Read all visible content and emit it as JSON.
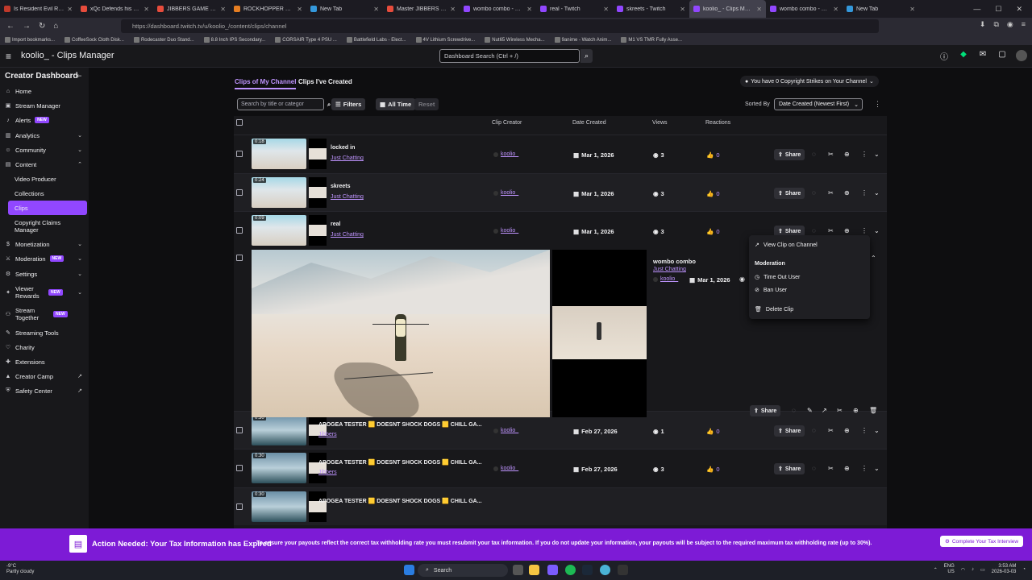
{
  "browser": {
    "tabs": [
      {
        "label": "Is Resident Evil Requiem",
        "color": "#c0392b"
      },
      {
        "label": "xQc Defends his Basketb",
        "color": "#e74c3c"
      },
      {
        "label": "JIBBERS GAME #sking #",
        "color": "#e74c3c"
      },
      {
        "label": "ROCKHOPPER PENGUIN",
        "color": "#e67e22"
      },
      {
        "label": "New Tab",
        "color": "#3498db"
      },
      {
        "label": "Master JIBBERS Fast - Yo",
        "color": "#e74c3c"
      },
      {
        "label": "wombo combo - Twitch",
        "color": "#9147ff"
      },
      {
        "label": "real - Twitch",
        "color": "#9147ff"
      },
      {
        "label": "skreets - Twitch",
        "color": "#9147ff"
      },
      {
        "label": "koolio_ - Clips Manager",
        "color": "#9147ff",
        "active": true
      },
      {
        "label": "wombo combo - Twitch",
        "color": "#9147ff"
      },
      {
        "label": "New Tab",
        "color": "#3498db"
      }
    ],
    "url": "https://dashboard.twitch.tv/u/koolio_/content/clips/channel",
    "bookmarks": [
      "Import bookmarks...",
      "CoffeeSock Cloth Disk...",
      "Rodecaster Duo Stand...",
      "8.8 Inch IPS Secondary...",
      "CORSAIR Type 4 PSU ...",
      "Battlefield Labs - Elect...",
      "4V Lithium Screwdrive...",
      "Nut65 Wireless Mecha...",
      "9anime - Watch Anim...",
      "M1 VS TMR Fully Asse..."
    ]
  },
  "topnav": {
    "title": "koolio_ - Clips Manager",
    "search_placeholder": "Dashboard Search (Ctrl + /)"
  },
  "sidebar": {
    "title": "Creator Dashboard",
    "items": [
      {
        "label": "Home",
        "icon": "home-icon"
      },
      {
        "label": "Stream Manager",
        "icon": "broadcast-icon"
      },
      {
        "label": "Alerts",
        "icon": "bell-icon",
        "badge": "NEW"
      },
      {
        "label": "Analytics",
        "icon": "chart-icon"
      },
      {
        "label": "Community",
        "icon": "people-icon"
      },
      {
        "label": "Content",
        "icon": "film-icon"
      },
      {
        "label": "Video Producer"
      },
      {
        "label": "Collections"
      },
      {
        "label": "Clips"
      },
      {
        "label": "Copyright Claims Manager"
      },
      {
        "label": "Monetization",
        "icon": "dollar-icon"
      },
      {
        "label": "Moderation",
        "icon": "sword-icon",
        "badge": "NEW"
      },
      {
        "label": "Settings",
        "icon": "gear-icon"
      },
      {
        "label": "Viewer Rewards",
        "icon": "gift-icon",
        "badge": "NEW"
      },
      {
        "label": "Stream Together",
        "icon": "users-icon",
        "badge": "NEW"
      },
      {
        "label": "Streaming Tools",
        "icon": "tools-icon"
      },
      {
        "label": "Charity",
        "icon": "heart-icon"
      },
      {
        "label": "Extensions",
        "icon": "puzzle-icon"
      },
      {
        "label": "Creator Camp",
        "icon": "tent-icon"
      },
      {
        "label": "Safety Center",
        "icon": "shield-icon"
      }
    ]
  },
  "main": {
    "tabs": [
      "Clips of My Channel",
      "Clips I've Created"
    ],
    "strikes": "You have 0 Copyright Strikes on Your Channel",
    "search_placeholder": "Search by title or categor",
    "filters_label": "Filters",
    "time_label": "All Time",
    "reset_label": "Reset",
    "sorted_by_label": "Sorted By",
    "sort_value": "Date Created (Newest First)",
    "columns": [
      "Clip Creator",
      "Date Created",
      "Views",
      "Reactions"
    ],
    "share_label": "Share",
    "rows": [
      {
        "duration": "0:18",
        "title": "locked in",
        "category": "Just Chatting",
        "creator": "koolio_",
        "date": "Mar 1, 2026",
        "views": "3",
        "reactions": "0"
      },
      {
        "duration": "0:24",
        "title": "skreets",
        "category": "Just Chatting",
        "creator": "koolio_",
        "date": "Mar 1, 2026",
        "views": "3",
        "reactions": "0"
      },
      {
        "duration": "0:09",
        "title": "real",
        "category": "Just Chatting",
        "creator": "koolio_",
        "date": "Mar 1, 2026",
        "views": "3",
        "reactions": "0"
      },
      {
        "duration": "0:30",
        "title": "APOGEA TESTER 🟨 DOESNT SHOCK DOGS 🟨 CHILL GA...",
        "category": "Jibbers",
        "creator": "koolio_",
        "date": "Feb 27, 2026",
        "views": "1",
        "reactions": "0"
      },
      {
        "duration": "0:30",
        "title": "APOGEA TESTER 🟨 DOESNT SHOCK DOGS 🟨 CHILL GA...",
        "category": "Jibbers",
        "creator": "koolio_",
        "date": "Feb 27, 2026",
        "views": "3",
        "reactions": "0"
      },
      {
        "duration": "0:30",
        "title": "APOGEA TESTER 🟨 DOESNT SHOCK DOGS 🟨 CHILL GA..."
      }
    ],
    "expanded": {
      "title": "wombo combo",
      "category": "Just Chatting",
      "creator": "koolio_",
      "date": "Mar 1, 2026"
    }
  },
  "menu": {
    "view_clip": "View Clip on Channel",
    "moderation_heading": "Moderation",
    "timeout": "Time Out User",
    "ban": "Ban User",
    "delete": "Delete Clip"
  },
  "banner": {
    "title": "Action Needed: Your Tax Information has Expired",
    "text": "To ensure your payouts reflect the correct tax withholding rate you must resubmit your tax information. If you do not update your information, your payouts will be subject to the required maximum tax withholding rate (up to 30%).",
    "button": "Complete Your Tax Interview"
  },
  "taskbar": {
    "temp": "-9°C",
    "weather": "Partly cloudy",
    "search": "Search",
    "lang1": "ENG",
    "lang2": "US",
    "time": "3:53 AM",
    "date": "2026-03-03"
  }
}
